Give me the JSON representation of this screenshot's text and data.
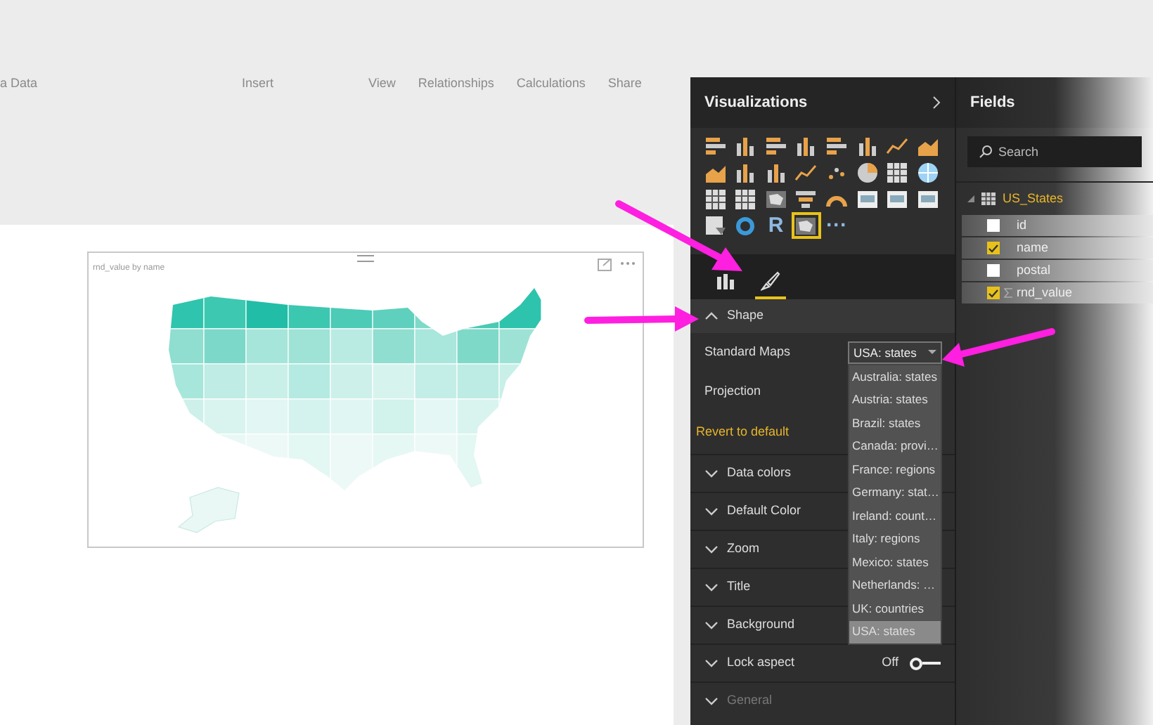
{
  "menu": [
    "a Data",
    "Insert",
    "View",
    "Relationships",
    "Calculations",
    "Share"
  ],
  "visual": {
    "title": "rnd_value by name"
  },
  "visualizations": {
    "title": "Visualizations",
    "gallery": [
      {
        "kind": "hbar",
        "selected": false
      },
      {
        "kind": "column",
        "selected": false
      },
      {
        "kind": "hbar",
        "selected": false
      },
      {
        "kind": "column",
        "selected": false
      },
      {
        "kind": "hbar",
        "selected": false
      },
      {
        "kind": "column",
        "selected": false
      },
      {
        "kind": "line",
        "selected": false
      },
      {
        "kind": "area",
        "selected": false
      },
      {
        "kind": "area",
        "selected": false
      },
      {
        "kind": "column",
        "selected": false
      },
      {
        "kind": "column",
        "selected": false
      },
      {
        "kind": "line",
        "selected": false
      },
      {
        "kind": "scatter",
        "selected": false
      },
      {
        "kind": "pie",
        "selected": false
      },
      {
        "kind": "table",
        "selected": false
      },
      {
        "kind": "globe",
        "selected": false
      },
      {
        "kind": "table",
        "selected": false
      },
      {
        "kind": "table",
        "selected": false
      },
      {
        "kind": "map",
        "selected": false
      },
      {
        "kind": "funnel",
        "selected": false
      },
      {
        "kind": "gauge",
        "selected": false
      },
      {
        "kind": "card",
        "selected": false
      },
      {
        "kind": "card",
        "selected": false
      },
      {
        "kind": "card",
        "selected": false
      },
      {
        "kind": "slicer",
        "selected": false
      },
      {
        "kind": "donut",
        "selected": false
      },
      {
        "kind": "text",
        "label": "R",
        "selected": false
      },
      {
        "kind": "map",
        "selected": true
      },
      {
        "kind": "text",
        "label": "···",
        "selected": false
      }
    ],
    "tabs": [
      {
        "kind": "fields",
        "selected": false
      },
      {
        "kind": "format",
        "selected": true
      }
    ],
    "shape": {
      "label": "Shape",
      "expanded": true,
      "standard_maps": {
        "label": "Standard Maps",
        "value": "USA: states",
        "options": [
          {
            "label": "Australia: states",
            "selected": false
          },
          {
            "label": "Austria: states",
            "selected": false
          },
          {
            "label": "Brazil: states",
            "selected": false
          },
          {
            "label": "Canada: provi…",
            "selected": false
          },
          {
            "label": "France: regions",
            "selected": false
          },
          {
            "label": "Germany: stat…",
            "selected": false
          },
          {
            "label": "Ireland: count…",
            "selected": false
          },
          {
            "label": "Italy: regions",
            "selected": false
          },
          {
            "label": "Mexico: states",
            "selected": false
          },
          {
            "label": "Netherlands: …",
            "selected": false
          },
          {
            "label": "UK: countries",
            "selected": false
          },
          {
            "label": "USA: states",
            "selected": true
          }
        ]
      },
      "projection": "Projection",
      "revert": "Revert to default"
    },
    "sections": [
      {
        "label": "Data colors"
      },
      {
        "label": "Default Color"
      },
      {
        "label": "Zoom"
      },
      {
        "label": "Title"
      },
      {
        "label": "Background"
      },
      {
        "label": "Lock aspect",
        "toggle": {
          "text": "Off",
          "on": false
        }
      },
      {
        "label": "General"
      }
    ]
  },
  "fields": {
    "title": "Fields",
    "search": {
      "placeholder": "Search"
    },
    "table": {
      "name": "US_States",
      "expanded": true,
      "children": [
        {
          "name": "id",
          "checked": false,
          "sigma": false
        },
        {
          "name": "name",
          "checked": true,
          "sigma": false
        },
        {
          "name": "postal",
          "checked": false,
          "sigma": false
        },
        {
          "name": "rnd_value",
          "checked": true,
          "sigma": true
        }
      ]
    }
  }
}
